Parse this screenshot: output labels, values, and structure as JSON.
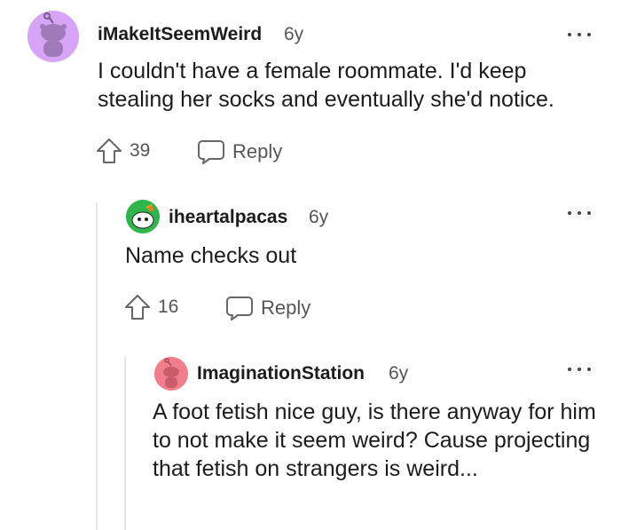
{
  "comments": [
    {
      "username": "iMakeItSeemWeird",
      "age": "6y",
      "body": "I couldn't have a female roommate. I'd keep stealing her socks and eventually she'd notice.",
      "votes": "39",
      "reply_label": "Reply",
      "avatar_color": "#d8a4f7"
    },
    {
      "username": "iheartalpacas",
      "age": "6y",
      "body": "Name checks out",
      "votes": "16",
      "reply_label": "Reply",
      "avatar_color": "#2fb54b"
    },
    {
      "username": "ImaginationStation",
      "age": "6y",
      "body": "A foot fetish nice guy, is there anyway for him to not make it seem weird? Cause projecting that fetish on strangers is weird...",
      "avatar_color": "#f27e8b"
    }
  ]
}
